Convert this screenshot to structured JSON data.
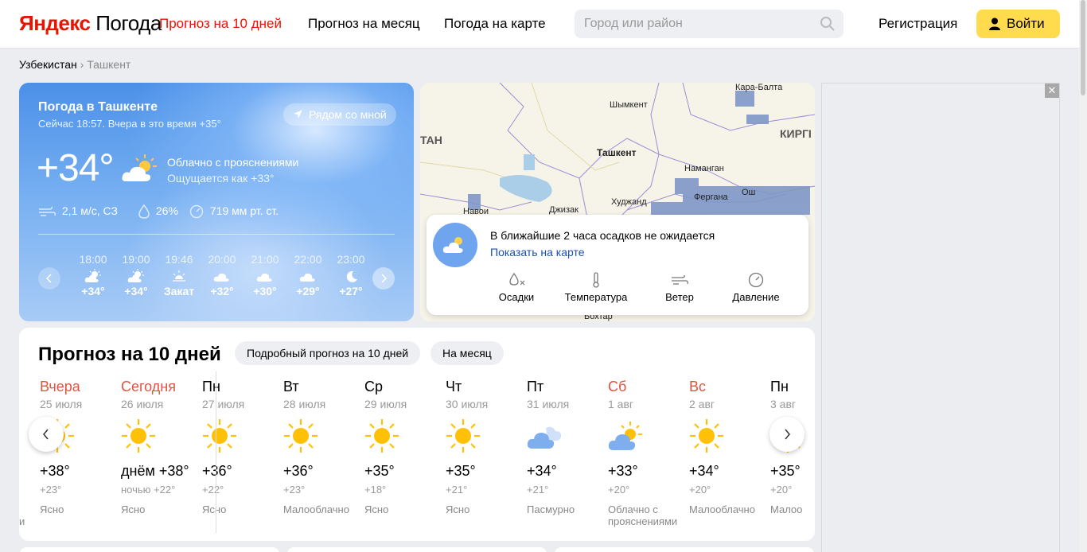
{
  "header": {
    "logo_brand": "Яндекс",
    "logo_service": "Погода",
    "nav": [
      "Прогноз на 10 дней",
      "Прогноз на месяц",
      "Погода на карте"
    ],
    "search_placeholder": "Город или район",
    "register": "Регистрация",
    "login": "Войти"
  },
  "breadcrumb": {
    "country": "Узбекистан",
    "sep": "›",
    "city": "Ташкент"
  },
  "current": {
    "title": "Погода в Ташкенте",
    "subtitle": "Сейчас 18:57. Вчера в это время +35°",
    "near_me": "Рядом со мной",
    "temp": "+34°",
    "condition": "Облачно с прояснениями",
    "feels_like": "Ощущается как +33°",
    "wind": "2,1 м/с, СЗ",
    "humidity": "26%",
    "pressure": "719 мм рт. ст.",
    "hours": [
      {
        "time": "18:00",
        "value": "+34°",
        "icon": "sun-cloud-icon"
      },
      {
        "time": "19:00",
        "value": "+34°",
        "icon": "sun-cloud-icon"
      },
      {
        "time": "19:46",
        "value": "Закат",
        "icon": "sunset-icon"
      },
      {
        "time": "20:00",
        "value": "+32°",
        "icon": "cloud-icon"
      },
      {
        "time": "21:00",
        "value": "+30°",
        "icon": "cloud-icon"
      },
      {
        "time": "22:00",
        "value": "+29°",
        "icon": "cloud-icon"
      },
      {
        "time": "23:00",
        "value": "+27°",
        "icon": "moon-icon"
      }
    ]
  },
  "map": {
    "labels": [
      "Кара-Балта",
      "Шымкент",
      "Ташкент",
      "Наманган",
      "Фергана",
      "Ош",
      "Худжанд",
      "Навои",
      "Джизак",
      "Бохтар",
      "ТАН",
      "КИРГІ"
    ],
    "precip_message": "В ближайшие 2 часа осадков не ожидается",
    "show_on_map": "Показать на карте",
    "tabs": [
      "Осадки",
      "Температура",
      "Ветер",
      "Давление"
    ]
  },
  "forecast": {
    "title": "Прогноз на 10 дней",
    "pill_detailed": "Подробный прогноз на 10 дней",
    "pill_month": "На месяц",
    "edge_char": "и",
    "days": [
      {
        "name": "Вчера",
        "date": "25 июля",
        "hi": "+38°",
        "lo": "+23°",
        "cond": "Ясно",
        "red": true,
        "icon": "sun-icon"
      },
      {
        "name": "Сегодня",
        "date": "26 июля",
        "hi": "днём +38°",
        "lo": "ночью +22°",
        "cond": "Ясно",
        "red": true,
        "icon": "sun-icon"
      },
      {
        "name": "Пн",
        "date": "27 июля",
        "hi": "+36°",
        "lo": "+22°",
        "cond": "Ясно",
        "red": false,
        "icon": "sun-icon"
      },
      {
        "name": "Вт",
        "date": "28 июля",
        "hi": "+36°",
        "lo": "+23°",
        "cond": "Малооблачно",
        "red": false,
        "icon": "sun-icon"
      },
      {
        "name": "Ср",
        "date": "29 июля",
        "hi": "+35°",
        "lo": "+18°",
        "cond": "Ясно",
        "red": false,
        "icon": "sun-icon"
      },
      {
        "name": "Чт",
        "date": "30 июля",
        "hi": "+35°",
        "lo": "+21°",
        "cond": "Ясно",
        "red": false,
        "icon": "sun-icon"
      },
      {
        "name": "Пт",
        "date": "31 июля",
        "hi": "+34°",
        "lo": "+21°",
        "cond": "Пасмурно",
        "red": false,
        "icon": "cloud-icon"
      },
      {
        "name": "Сб",
        "date": "1 авг",
        "hi": "+33°",
        "lo": "+20°",
        "cond": "Облачно с прояснениями",
        "red": true,
        "icon": "sun-cloud-icon"
      },
      {
        "name": "Вс",
        "date": "2 авг",
        "hi": "+34°",
        "lo": "+20°",
        "cond": "Малооблачно",
        "red": true,
        "icon": "sun-icon"
      },
      {
        "name": "Пн",
        "date": "3 авг",
        "hi": "+35°",
        "lo": "+20°",
        "cond": "Малоо",
        "red": false,
        "icon": "sun-icon"
      }
    ]
  },
  "ad": {
    "close": "✕"
  },
  "colors": {
    "brand_red": "#e61400",
    "login_yellow": "#ffdb4d",
    "weekend_red": "#e0533d",
    "link_blue": "#1a4fb5"
  }
}
